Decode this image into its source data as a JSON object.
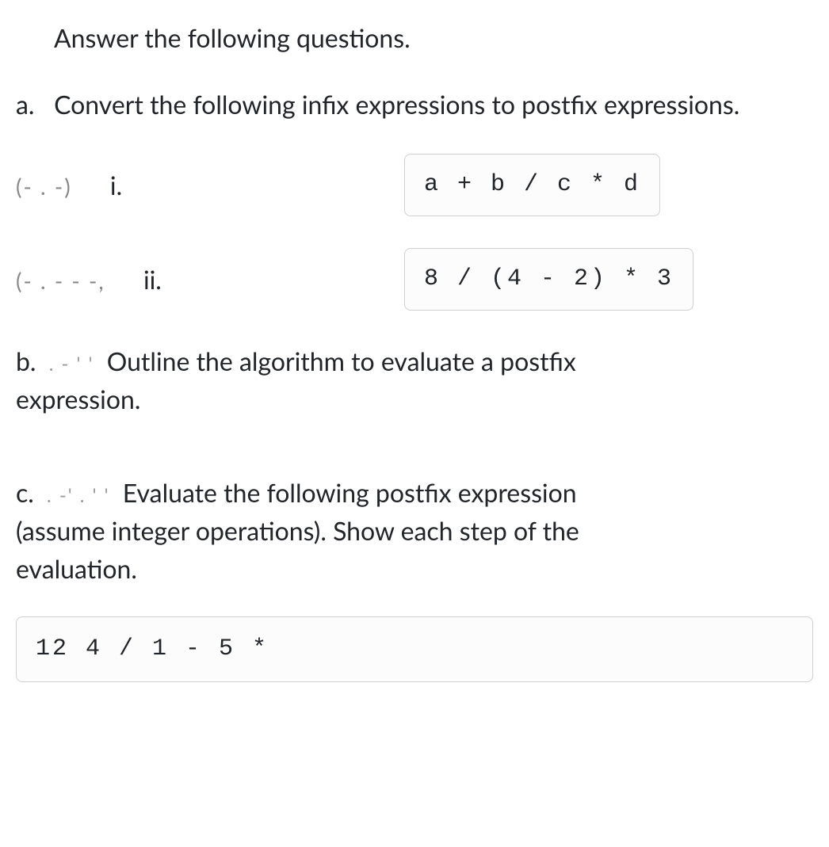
{
  "intro": "Answer the following questions.",
  "partA": {
    "label": "a.",
    "text": "Convert the following infix expressions to postfix expressions.",
    "items": [
      {
        "redacted": "(- .      -)",
        "roman": "i.",
        "expression": "a + b / c * d"
      },
      {
        "redacted": "(- . - - -,",
        "roman": "ii.",
        "expression": "8 / (4 - 2) * 3"
      }
    ]
  },
  "partB": {
    "label": "b.",
    "redacted": ".  -  ' '",
    "text_before": "Outline the algorithm to evaluate a postfix",
    "text_after": "expression."
  },
  "partC": {
    "label": "c.",
    "redacted": ". -' .     ' '",
    "text_line1": "Evaluate the following postfix expression",
    "text_line2": "(assume integer operations). Show each step of the",
    "text_line3": "evaluation.",
    "expression": "12 4 / 1 - 5 *"
  }
}
